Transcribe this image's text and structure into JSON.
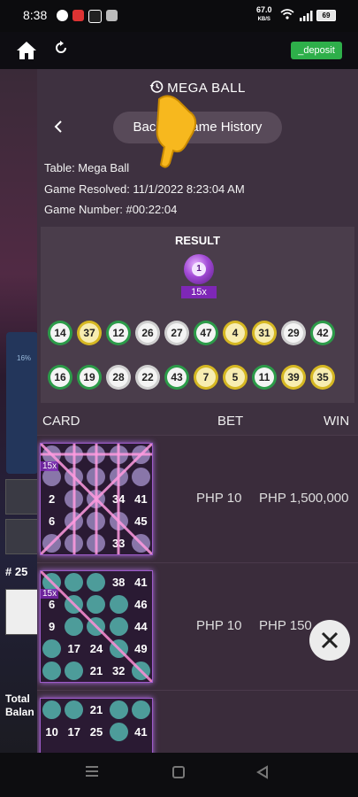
{
  "status_bar": {
    "time": "8:38",
    "net_speed_value": "67.0",
    "net_speed_unit": "KB/S",
    "battery": "69"
  },
  "app_bar": {
    "deposit_label": "_deposit",
    "home_icon": "home-icon",
    "refresh_icon": "refresh-icon"
  },
  "background": {
    "percent_label": "16%",
    "round_label": "# 25",
    "total_label_1": "Total",
    "total_label_2": "Balan"
  },
  "panel": {
    "title": "MEGA BALL",
    "back_button": "Back to Game History",
    "table_info": "Table: Mega Ball",
    "game_resolved": "Game Resolved: 11/1/2022 8:23:04 AM",
    "game_number": "Game Number: #00:22:04"
  },
  "result": {
    "label": "RESULT",
    "mega_ball": "1",
    "multiplier": "15x",
    "row1": [
      {
        "n": "14",
        "c": "green"
      },
      {
        "n": "37",
        "c": "yellow"
      },
      {
        "n": "12",
        "c": "green"
      },
      {
        "n": "26",
        "c": "white"
      },
      {
        "n": "27",
        "c": "white"
      },
      {
        "n": "47",
        "c": "green"
      },
      {
        "n": "4",
        "c": "yellow"
      },
      {
        "n": "31",
        "c": "yellow"
      },
      {
        "n": "29",
        "c": "white"
      },
      {
        "n": "42",
        "c": "green"
      }
    ],
    "row2": [
      {
        "n": "16",
        "c": "green"
      },
      {
        "n": "19",
        "c": "green"
      },
      {
        "n": "28",
        "c": "white"
      },
      {
        "n": "22",
        "c": "white"
      },
      {
        "n": "43",
        "c": "green"
      },
      {
        "n": "7",
        "c": "yellow"
      },
      {
        "n": "5",
        "c": "yellow"
      },
      {
        "n": "11",
        "c": "green"
      },
      {
        "n": "39",
        "c": "yellow"
      },
      {
        "n": "35",
        "c": "yellow"
      }
    ]
  },
  "table": {
    "headers": {
      "card": "CARD",
      "bet": "BET",
      "win": "WIN"
    },
    "rows": [
      {
        "bet": "PHP 10",
        "win": "PHP 1,500,000",
        "style": "purple",
        "badge": "15x",
        "cells": [
          "",
          "",
          "",
          "",
          "",
          "",
          "",
          "",
          "",
          "",
          "2",
          "",
          "",
          "34",
          "41",
          "6",
          "",
          "",
          "",
          "45",
          "",
          "",
          "",
          "33",
          ""
        ]
      },
      {
        "bet": "PHP 10",
        "win": "PHP 150",
        "style": "teal",
        "badge": "15x",
        "cells": [
          "",
          "",
          "",
          "38",
          "41",
          "6",
          "",
          "",
          "",
          "46",
          "9",
          "",
          "",
          "",
          "44",
          "",
          "17",
          "24",
          "",
          "49",
          "",
          "",
          "21",
          "32",
          ""
        ]
      },
      {
        "bet": "",
        "win": "",
        "style": "teal",
        "badge": "",
        "cells": [
          "",
          "",
          "21",
          "",
          "",
          "10",
          "17",
          "25",
          "",
          "41"
        ]
      }
    ]
  },
  "nav": {
    "recent_icon": "recents-icon",
    "home_icon": "nav-home-icon",
    "back_icon": "nav-back-icon"
  }
}
